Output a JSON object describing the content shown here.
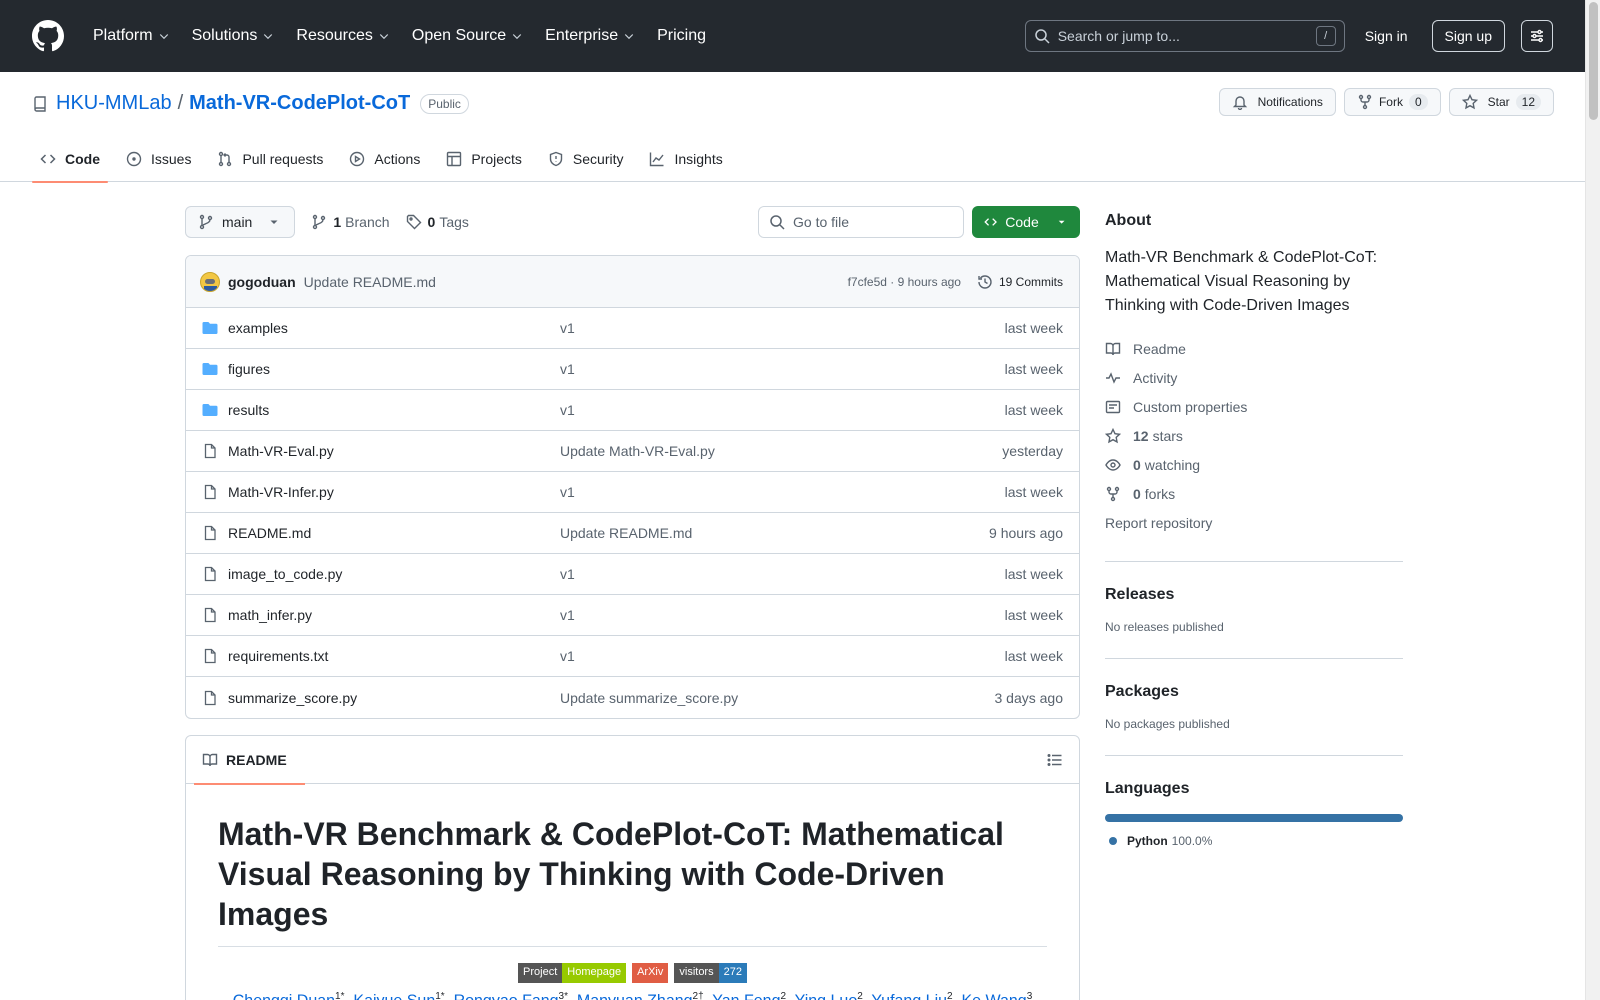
{
  "header": {
    "nav": [
      "Platform",
      "Solutions",
      "Resources",
      "Open Source",
      "Enterprise",
      "Pricing"
    ],
    "search_placeholder": "Search or jump to...",
    "search_key": "/",
    "sign_in": "Sign in",
    "sign_up": "Sign up"
  },
  "repo": {
    "owner": "HKU-MMLab",
    "separator": "/",
    "name": "Math-VR-CodePlot-CoT",
    "visibility": "Public",
    "notifications_label": "Notifications",
    "fork_label": "Fork",
    "fork_count": "0",
    "star_label": "Star",
    "star_count": "12",
    "tabs": [
      "Code",
      "Issues",
      "Pull requests",
      "Actions",
      "Projects",
      "Security",
      "Insights"
    ]
  },
  "toolbar": {
    "branch": "main",
    "branch_count": "1",
    "branch_label": "Branch",
    "tag_count": "0",
    "tag_label": "Tags",
    "goto_placeholder": "Go to file",
    "code_button": "Code"
  },
  "commit": {
    "author": "gogoduan",
    "message": "Update README.md",
    "sha_time": "f7cfe5d · 9 hours ago",
    "commits": "19 Commits"
  },
  "files": [
    {
      "name": "examples",
      "type": "dir",
      "message": "v1",
      "date": "last week"
    },
    {
      "name": "figures",
      "type": "dir",
      "message": "v1",
      "date": "last week"
    },
    {
      "name": "results",
      "type": "dir",
      "message": "v1",
      "date": "last week"
    },
    {
      "name": "Math-VR-Eval.py",
      "type": "file",
      "message": "Update Math-VR-Eval.py",
      "date": "yesterday"
    },
    {
      "name": "Math-VR-Infer.py",
      "type": "file",
      "message": "v1",
      "date": "last week"
    },
    {
      "name": "README.md",
      "type": "file",
      "message": "Update README.md",
      "date": "9 hours ago"
    },
    {
      "name": "image_to_code.py",
      "type": "file",
      "message": "v1",
      "date": "last week"
    },
    {
      "name": "math_infer.py",
      "type": "file",
      "message": "v1",
      "date": "last week"
    },
    {
      "name": "requirements.txt",
      "type": "file",
      "message": "v1",
      "date": "last week"
    },
    {
      "name": "summarize_score.py",
      "type": "file",
      "message": "Update summarize_score.py",
      "date": "3 days ago"
    }
  ],
  "readme": {
    "tab": "README",
    "title": "Math-VR Benchmark & CodePlot-CoT: Mathematical Visual Reasoning by Thinking with Code-Driven Images",
    "badges": {
      "project_a": "Project",
      "project_b": "Homepage",
      "arxiv": "ArXiv",
      "visitors_a": "visitors",
      "visitors_b": "272"
    },
    "authors": [
      {
        "name": "Chengqi Duan",
        "sup": "1*"
      },
      {
        "name": "Kaiyue Sun",
        "sup": "1*"
      },
      {
        "name": "Rongyao Fang",
        "sup": "3*"
      },
      {
        "name": "Manyuan Zhang",
        "sup": "2†"
      },
      {
        "name": "Yan Feng",
        "sup": "2"
      },
      {
        "name": "Ying Luo",
        "sup": "2"
      },
      {
        "name": "Yufang Liu",
        "sup": "2"
      },
      {
        "name": "Ke Wang",
        "sup": "3"
      }
    ]
  },
  "about": {
    "title": "About",
    "description": "Math-VR Benchmark & CodePlot-CoT: Mathematical Visual Reasoning by Thinking with Code-Driven Images",
    "readme": "Readme",
    "activity": "Activity",
    "custom_properties": "Custom properties",
    "stars_count": "12",
    "stars_label": "stars",
    "watching_count": "0",
    "watching_label": "watching",
    "forks_count": "0",
    "forks_label": "forks",
    "report": "Report repository"
  },
  "releases": {
    "title": "Releases",
    "empty": "No releases published"
  },
  "packages": {
    "title": "Packages",
    "empty": "No packages published"
  },
  "languages": {
    "title": "Languages",
    "items": [
      {
        "name": "Python",
        "percent": "100.0%",
        "share": 1.0
      }
    ]
  },
  "colors": {
    "accent_green": "#1f883d",
    "header_bg": "#24292f",
    "link": "#0969da",
    "python": "#3572a5"
  }
}
